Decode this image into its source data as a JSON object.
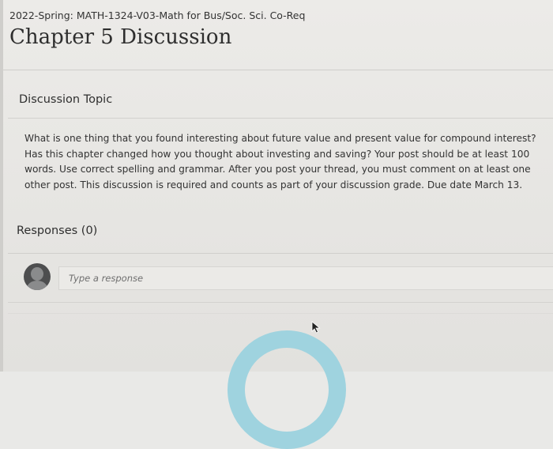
{
  "course": {
    "title": "2022-Spring: MATH-1324-V03-Math for Bus/Soc. Sci. Co-Req"
  },
  "page": {
    "title": "Chapter 5 Discussion"
  },
  "topic": {
    "heading": "Discussion Topic",
    "body": "What is one thing that you found interesting about future value and present value for compound interest? Has this chapter changed how you thought about investing and saving? Your post should be at least 100 words. Use correct spelling and grammar.  After you post your thread, you must comment on at least one other post.  This discussion is required and counts as part of your discussion grade.  Due date March 13."
  },
  "responses": {
    "heading": "Responses (0)",
    "placeholder": "Type a response",
    "value": ""
  },
  "icons": {
    "avatar": "user-avatar-icon",
    "cursor": "mouse-cursor-icon"
  },
  "colors": {
    "accent": "#9fd3df",
    "avatar": "#4d4e4f"
  }
}
